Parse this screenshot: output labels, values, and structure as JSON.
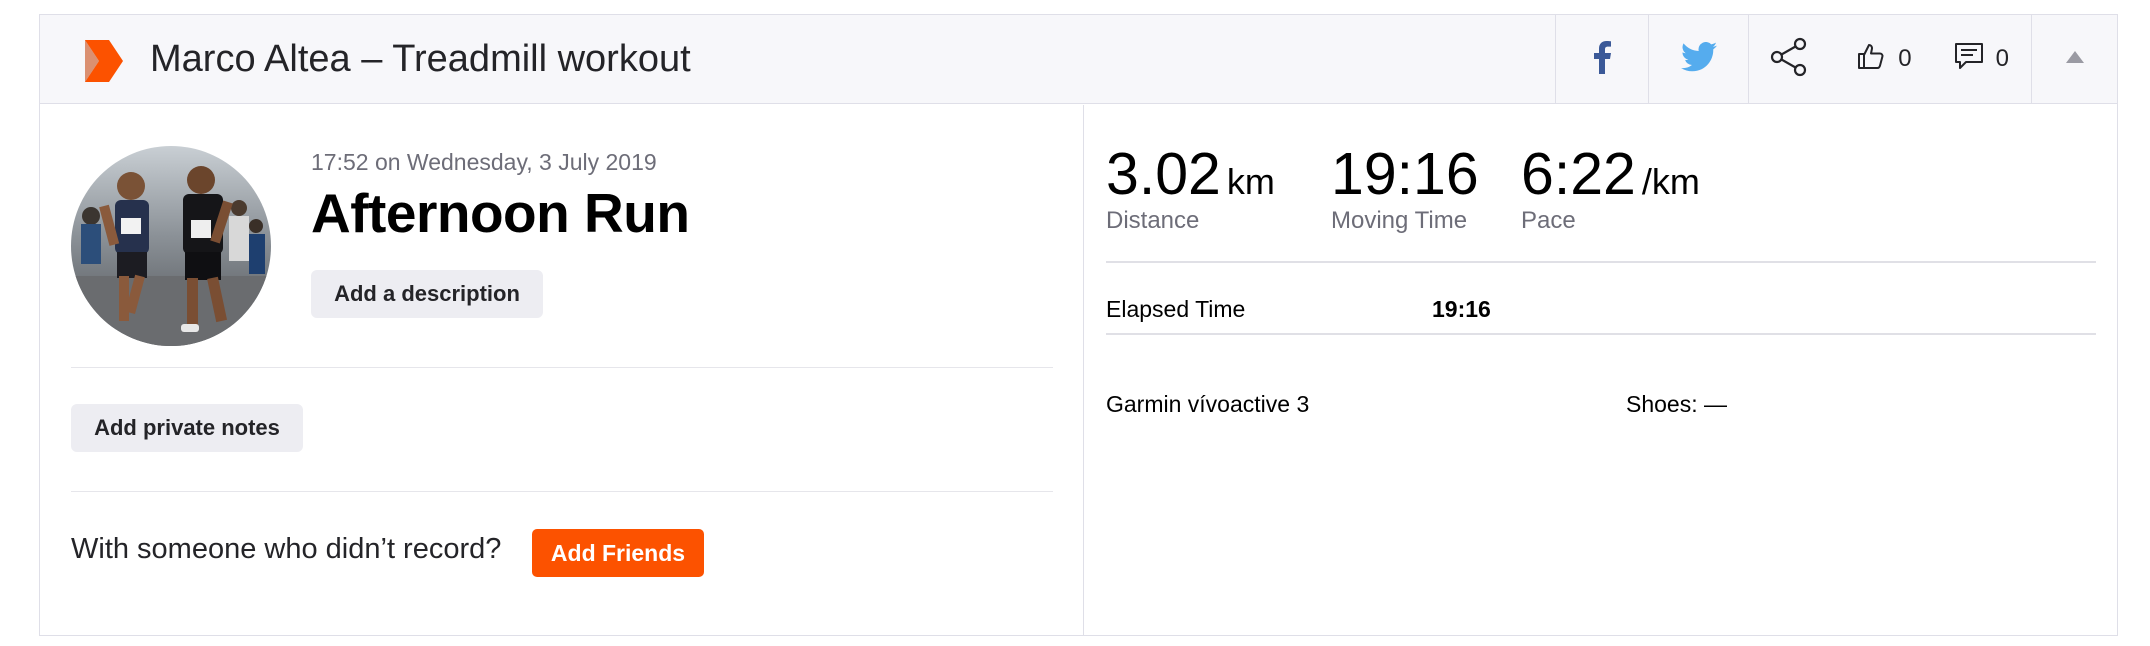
{
  "header": {
    "title": "Marco Altea – Treadmill workout",
    "kudos_count": "0",
    "comments_count": "0"
  },
  "activity": {
    "timestamp": "17:52 on Wednesday, 3 July 2019",
    "title": "Afternoon Run",
    "add_description_label": "Add a description",
    "add_private_notes_label": "Add private notes",
    "friends_prompt": "With someone who didn’t record?",
    "add_friends_label": "Add Friends"
  },
  "stats": {
    "distance": {
      "value": "3.02",
      "unit": "km",
      "label": "Distance"
    },
    "moving_time": {
      "value": "19:16",
      "label": "Moving Time"
    },
    "pace": {
      "value": "6:22",
      "unit": "/km",
      "label": "Pace"
    },
    "elapsed_label": "Elapsed Time",
    "elapsed_value": "19:16",
    "device": "Garmin vívoactive 3",
    "shoes": "Shoes: —"
  },
  "icons": {
    "brand": "brand-chevron-icon",
    "facebook": "facebook-icon",
    "twitter": "twitter-icon",
    "share": "share-icon",
    "kudos": "thumbs-up-icon",
    "comment": "comment-icon",
    "collapse": "caret-up-icon"
  },
  "colors": {
    "brand": "#fc5200",
    "facebook": "#3b5998",
    "twitter": "#55acee",
    "header_bg": "#f7f7fa"
  }
}
